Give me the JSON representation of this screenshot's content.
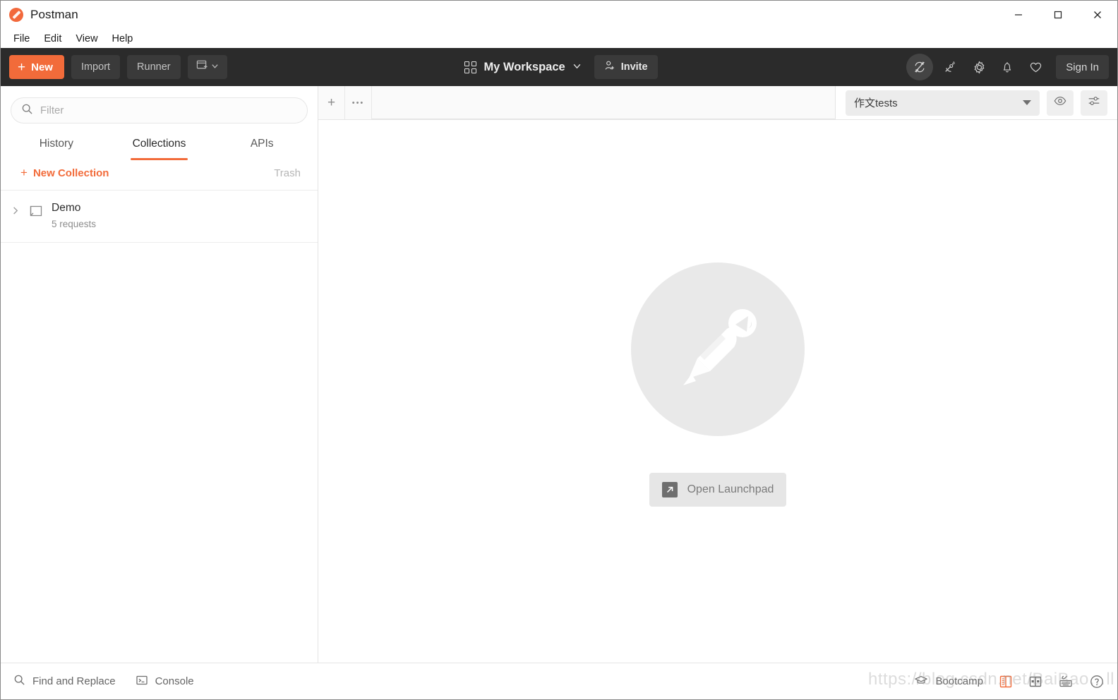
{
  "window": {
    "title": "Postman",
    "logo_icon": "postman-logo-icon",
    "controls": {
      "minimize": "minimize-icon",
      "maximize": "maximize-icon",
      "close": "close-icon"
    }
  },
  "menubar": {
    "items": [
      {
        "label": "File"
      },
      {
        "label": "Edit"
      },
      {
        "label": "View"
      },
      {
        "label": "Help"
      }
    ]
  },
  "toolbar": {
    "new_label": "New",
    "new_plus": "+",
    "import_label": "Import",
    "runner_label": "Runner",
    "new_window_icon": "new-window-icon",
    "new_window_caret_icon": "chevron-down-icon",
    "workspace_label": "My Workspace",
    "workspace_icon": "grid-icon",
    "workspace_caret_icon": "chevron-down-icon",
    "invite_label": "Invite",
    "invite_icon": "person-add-icon",
    "icons": {
      "sync_off": "sync-off-icon",
      "satellite": "satellite-icon",
      "settings": "gear-icon",
      "notifications": "bell-icon",
      "favorites": "heart-icon"
    },
    "sign_in_label": "Sign In",
    "accent_color": "#f26b3a",
    "background_color": "#2b2b2b"
  },
  "sidebar": {
    "filter": {
      "placeholder": "Filter",
      "value": "",
      "icon": "search-icon"
    },
    "tabs": [
      {
        "label": "History",
        "active": false
      },
      {
        "label": "Collections",
        "active": true
      },
      {
        "label": "APIs",
        "active": false
      }
    ],
    "actions": {
      "new_collection_label": "New Collection",
      "new_collection_plus": "+",
      "trash_label": "Trash"
    },
    "collections": [
      {
        "name": "Demo",
        "meta": "5 requests",
        "expand_icon": "chevron-right-icon",
        "folder_icon": "folder-icon"
      }
    ]
  },
  "main": {
    "tabbar": {
      "new_tab_icon": "plus-icon",
      "new_tab_label": "+",
      "more_options_icon": "ellipsis-icon",
      "more_options_label": "•••"
    },
    "environment": {
      "selected": "作文tests",
      "caret_icon": "chevron-down-icon",
      "eye_icon": "eye-icon",
      "settings_icon": "sliders-icon"
    },
    "empty_state": {
      "watermark_icon": "postman-pen-icon",
      "launchpad_label": "Open Launchpad",
      "launchpad_icon": "external-link-icon"
    }
  },
  "statusbar": {
    "find_replace_label": "Find and Replace",
    "find_replace_icon": "search-icon",
    "console_label": "Console",
    "console_icon": "terminal-icon",
    "bootcamp_label": "Bootcamp",
    "bootcamp_icon": "graduation-cap-icon",
    "layout_two_pane_icon": "layout-two-pane-icon",
    "layout_split_icon": "layout-split-icon",
    "keyboard_icon": "keyboard-icon",
    "help_icon": "help-circle-icon",
    "active_layout_color": "#f26b3a"
  },
  "watermark": {
    "text": "https://blog.csdn.net/BaiBao…ll"
  }
}
